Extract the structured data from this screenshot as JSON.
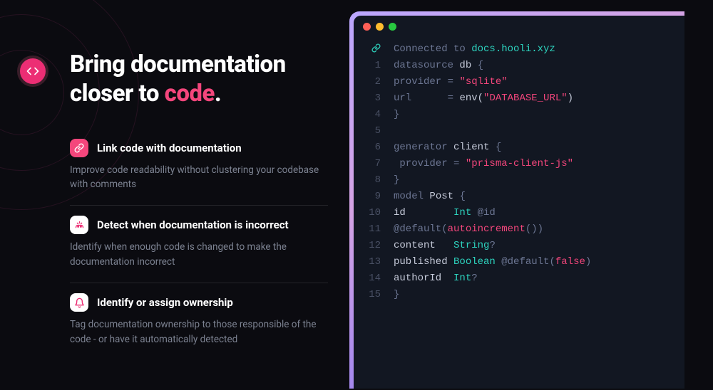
{
  "hero": {
    "title_pre": "Bring documentation closer to ",
    "title_accent": "code",
    "title_post": "."
  },
  "features": [
    {
      "icon": "link-icon",
      "title": "Link code with documentation",
      "desc": "Improve code readability without clustering your codebase with comments"
    },
    {
      "icon": "detect-icon",
      "title": "Detect when documentation is incorrect",
      "desc": "Identify when enough code is changed to make the documentation incorrect"
    },
    {
      "icon": "owner-icon",
      "title": "Identify or assign ownership",
      "desc": "Tag documentation ownership to those responsible of the code - or have it automatically detected"
    }
  ],
  "code": {
    "connected_pre": "Connected to ",
    "connected_host": "docs.hooli.xyz",
    "lines": [
      {
        "n": "1",
        "tokens": [
          [
            "kw",
            "datasource "
          ],
          [
            "id",
            "db "
          ],
          [
            "punc",
            "{"
          ]
        ]
      },
      {
        "n": "2",
        "tokens": [
          [
            "kw",
            "provider "
          ],
          [
            "eq",
            "= "
          ],
          [
            "str",
            "\"sqlite\""
          ]
        ]
      },
      {
        "n": "3",
        "tokens": [
          [
            "kw",
            "url      "
          ],
          [
            "eq",
            "= "
          ],
          [
            "id",
            "env("
          ],
          [
            "str",
            "\"DATABASE_URL\""
          ],
          [
            "id",
            ")"
          ]
        ]
      },
      {
        "n": "4",
        "tokens": [
          [
            "punc",
            "}"
          ]
        ]
      },
      {
        "n": "5",
        "tokens": []
      },
      {
        "n": "6",
        "tokens": [
          [
            "kw",
            "generator "
          ],
          [
            "id",
            "client "
          ],
          [
            "punc",
            "{"
          ]
        ]
      },
      {
        "n": "7",
        "tokens": [
          [
            "kw",
            " provider "
          ],
          [
            "eq",
            "= "
          ],
          [
            "str",
            "\"prisma-client-js\""
          ]
        ]
      },
      {
        "n": "8",
        "tokens": [
          [
            "punc",
            "}"
          ]
        ]
      },
      {
        "n": "9",
        "tokens": [
          [
            "kw",
            "model "
          ],
          [
            "id",
            "Post "
          ],
          [
            "punc",
            "{"
          ]
        ]
      },
      {
        "n": "10",
        "tokens": [
          [
            "id",
            "id        "
          ],
          [
            "type",
            "Int "
          ],
          [
            "attr",
            "@id"
          ]
        ]
      },
      {
        "n": "11",
        "tokens": [
          [
            "attr",
            "@default("
          ],
          [
            "fn",
            "autoincrement"
          ],
          [
            "attr",
            "())"
          ]
        ]
      },
      {
        "n": "12",
        "tokens": [
          [
            "id",
            "content   "
          ],
          [
            "type",
            "String"
          ],
          [
            "punc",
            "?"
          ]
        ]
      },
      {
        "n": "13",
        "tokens": [
          [
            "id",
            "published "
          ],
          [
            "type",
            "Boolean "
          ],
          [
            "attr",
            "@default("
          ],
          [
            "bool",
            "false"
          ],
          [
            "attr",
            ")"
          ]
        ]
      },
      {
        "n": "14",
        "tokens": [
          [
            "id",
            "authorId  "
          ],
          [
            "type",
            "Int"
          ],
          [
            "punc",
            "?"
          ]
        ]
      },
      {
        "n": "15",
        "tokens": [
          [
            "punc",
            "}"
          ]
        ]
      }
    ]
  },
  "colors": {
    "accent": "#f4467c",
    "teal": "#2dd4bf"
  }
}
